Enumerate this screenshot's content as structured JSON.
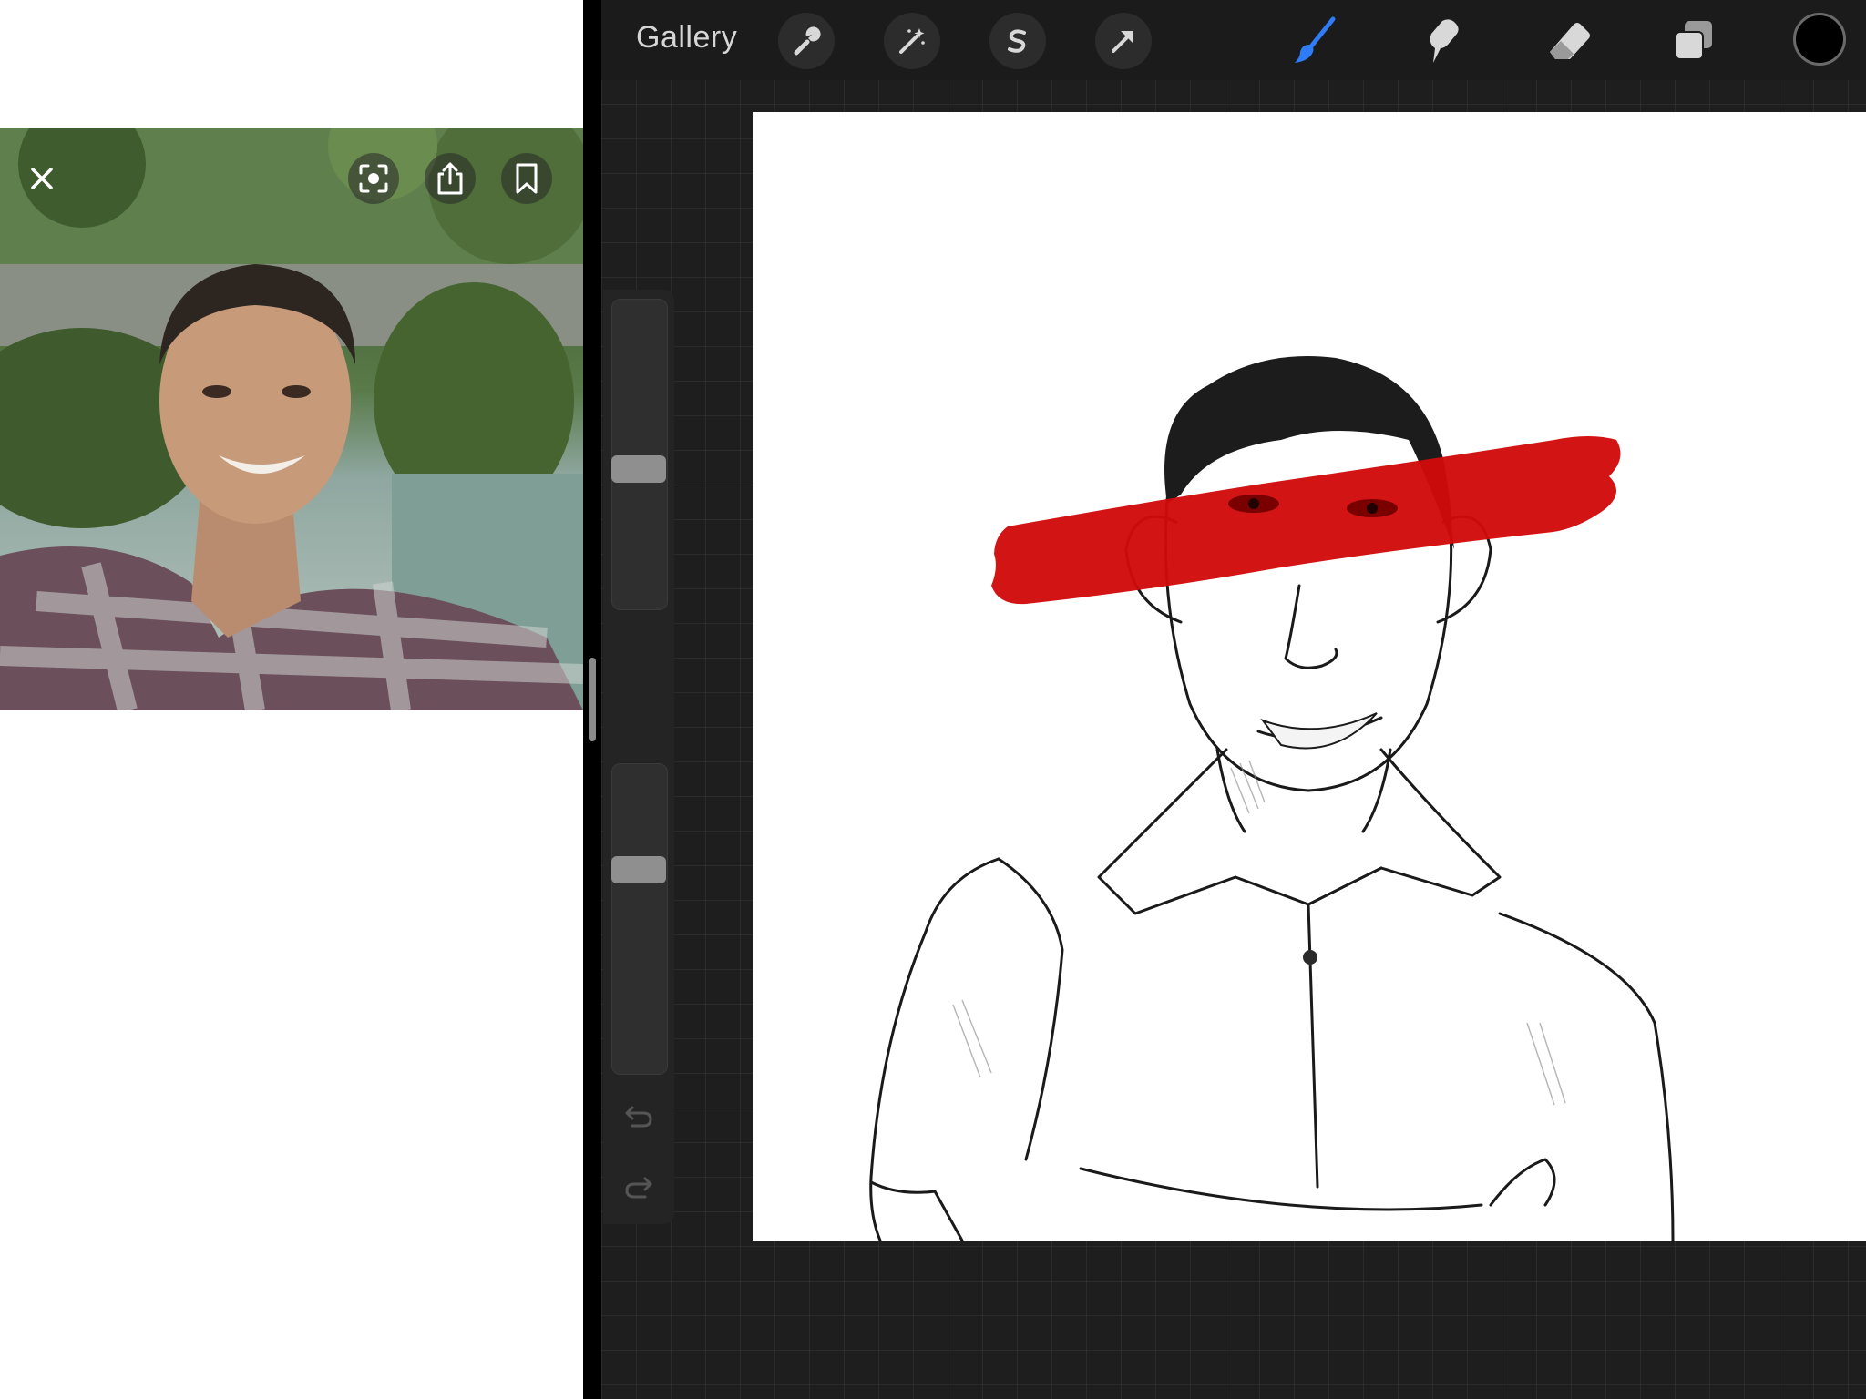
{
  "photo_viewer": {
    "controls": [
      "close-icon",
      "visual-lookup-icon",
      "share-icon",
      "bookmark-icon"
    ]
  },
  "procreate": {
    "toolbar": {
      "gallery_label": "Gallery",
      "tools": [
        "wrench-icon",
        "magic-wand-icon",
        "selection-icon",
        "transform-arrow-icon",
        "brush-icon",
        "smudge-icon",
        "eraser-icon",
        "layers-icon"
      ],
      "active_tool": "brush-icon",
      "active_color": "#000000",
      "accent_color": "#2f7cf6"
    },
    "sidebar": {
      "brush_size_level": 0.55,
      "opacity_level": 0.65,
      "undo_icon": "undo-icon",
      "redo_icon": "redo-icon"
    },
    "canvas": {
      "background": "#ffffff",
      "stroke_color": "#d10a0a"
    }
  }
}
